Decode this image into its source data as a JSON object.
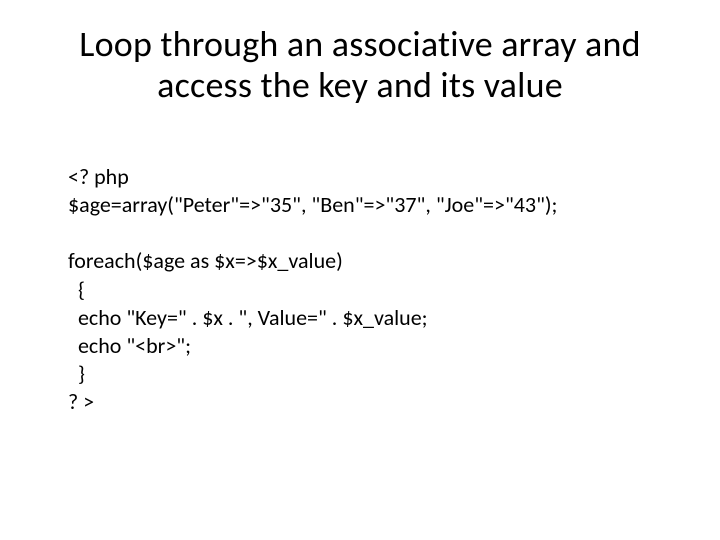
{
  "title": "Loop through an associative array and access the key and its value",
  "code": {
    "l1": "<? php",
    "l2": "$age=array(\"Peter\"=>\"35\", \"Ben\"=>\"37\", \"Joe\"=>\"43\");",
    "blank1": "",
    "l3": "foreach($age as $x=>$x_value)",
    "l4": "  {",
    "l5": "  echo \"Key=\" . $x . \", Value=\" . $x_value;",
    "l6": "  echo \"<br>\";",
    "l7": "  }",
    "l8": "? >"
  }
}
